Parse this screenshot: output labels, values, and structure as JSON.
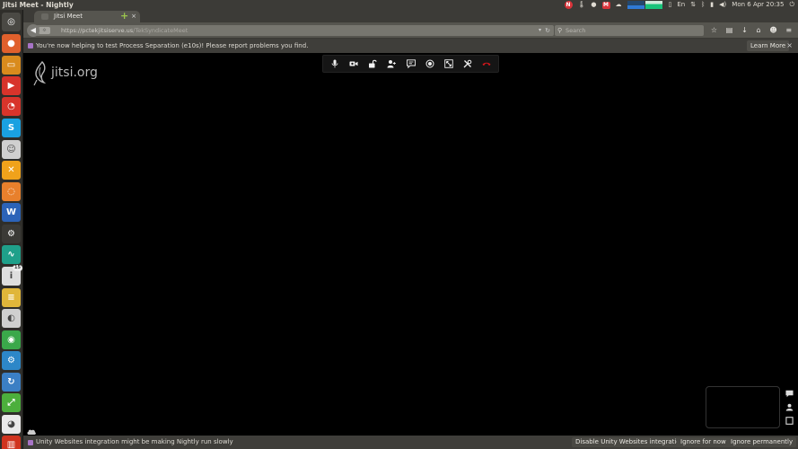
{
  "top_panel": {
    "window_title": "Jitsi Meet - Nightly",
    "clock": "Mon 6 Apr 20:35",
    "indicators": [
      "tray-red-icon",
      "thermometer-icon",
      "dot-icon",
      "mail-icon",
      "weather-icon",
      "system-monitor-graph",
      "clipboard-icon",
      "keyboard-icon",
      "network-icon",
      "bluetooth-icon",
      "battery-icon",
      "volume-icon",
      "session-icon"
    ],
    "tray_red_label": "N",
    "mail_label": "M",
    "keyboard_label": "En"
  },
  "launcher": {
    "items": [
      {
        "name": "dash-button",
        "color": "#4a4944",
        "glyph": "◎"
      },
      {
        "name": "firefox-nightly",
        "color": "#e0602c",
        "glyph": "●"
      },
      {
        "name": "files",
        "color": "#d98b1d",
        "glyph": "▭"
      },
      {
        "name": "media-player",
        "color": "#d8342b",
        "glyph": "▶"
      },
      {
        "name": "disk-utility",
        "color": "#d8342b",
        "glyph": "◔"
      },
      {
        "name": "skype",
        "color": "#1aa1e1",
        "glyph": "S"
      },
      {
        "name": "pidgin",
        "color": "#cfcfcf",
        "glyph": "☺"
      },
      {
        "name": "xchat",
        "color": "#f0a21b",
        "glyph": "✕"
      },
      {
        "name": "ubuntu-one",
        "color": "#e8802c",
        "glyph": "◌"
      },
      {
        "name": "libreoffice-writer",
        "color": "#2c63b8",
        "glyph": "W"
      },
      {
        "name": "steam",
        "color": "#3b3a36",
        "glyph": "⚙"
      },
      {
        "name": "system-monitor",
        "color": "#1fa08a",
        "glyph": "∿"
      },
      {
        "name": "info-badge-app",
        "color": "#dedede",
        "glyph": "i",
        "badge": "15"
      },
      {
        "name": "text-editor",
        "color": "#e0b63a",
        "glyph": "≡"
      },
      {
        "name": "vpn-client",
        "color": "#cfcfcf",
        "glyph": "◐"
      },
      {
        "name": "chrome",
        "color": "#3aa84a",
        "glyph": "◉"
      },
      {
        "name": "settings",
        "color": "#2d87c8",
        "glyph": "⚙"
      },
      {
        "name": "updater",
        "color": "#3b7fc4",
        "glyph": "↻"
      },
      {
        "name": "green-tool",
        "color": "#4caf3c",
        "glyph": "⤢"
      },
      {
        "name": "pie-app",
        "color": "#e9e9e9",
        "glyph": "◕"
      },
      {
        "name": "trash",
        "color": "#d0341f",
        "glyph": "▥"
      }
    ]
  },
  "browser": {
    "tab_title": "Jitsi Meet",
    "tab_close": "×",
    "new_tab": "+",
    "url_host": "https://pctekjitsiserve.us",
    "url_path": "/TekSyndicateMeet",
    "search_placeholder": "Search",
    "identity_label": "⟐",
    "notification_text": "You're now helping to test Process Separation (e10s)! Please report problems you find.",
    "notification_button": "Learn More"
  },
  "content": {
    "logo_text": "jitsi.org",
    "toolbar": [
      "microphone-icon",
      "camera-icon",
      "lock-icon",
      "invite-icon",
      "chat-icon",
      "share-icon",
      "fullscreen-icon",
      "settings-tools-icon",
      "hangup-icon"
    ],
    "hangup_color": "#d0161b"
  },
  "bottom_bar": {
    "text": "Unity Websites integration might be making Nightly run slowly",
    "buttons": [
      "Disable Unity Websites integration",
      "Ignore for now",
      "Ignore permanently"
    ]
  }
}
